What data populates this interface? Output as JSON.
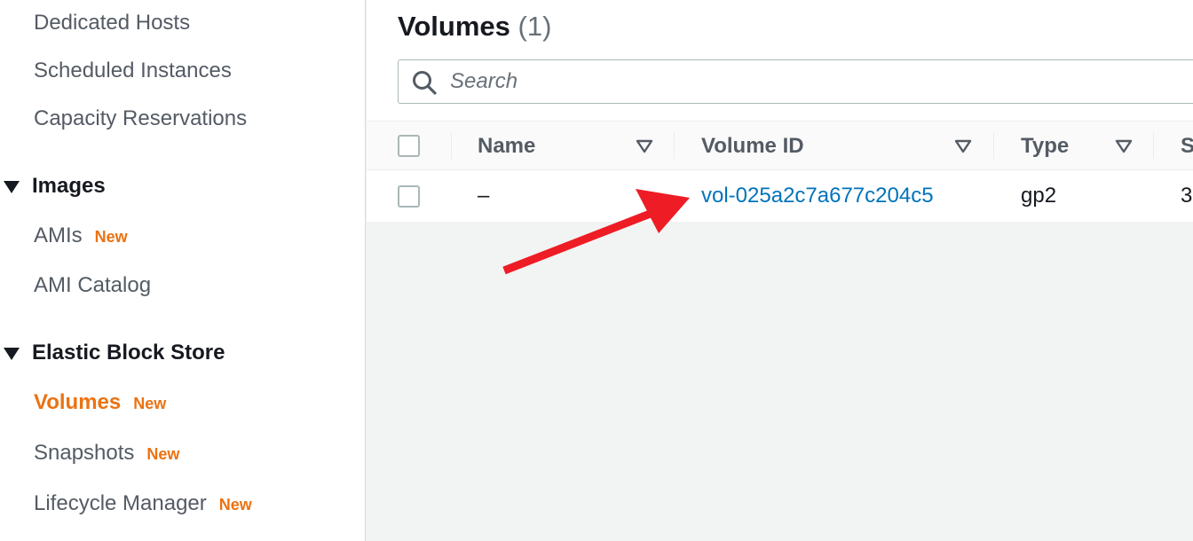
{
  "sidebar": {
    "items_top": [
      {
        "label": "Dedicated Hosts"
      },
      {
        "label": "Scheduled Instances"
      },
      {
        "label": "Capacity Reservations"
      }
    ],
    "images_section": {
      "label": "Images",
      "items": [
        {
          "label": "AMIs",
          "badge": "New"
        },
        {
          "label": "AMI Catalog"
        }
      ]
    },
    "ebs_section": {
      "label": "Elastic Block Store",
      "items": [
        {
          "label": "Volumes",
          "badge": "New",
          "active": true
        },
        {
          "label": "Snapshots",
          "badge": "New"
        },
        {
          "label": "Lifecycle Manager",
          "badge": "New"
        }
      ]
    }
  },
  "main": {
    "title": "Volumes",
    "count": "(1)",
    "search": {
      "placeholder": "Search",
      "value": ""
    },
    "table": {
      "columns": [
        "Name",
        "Volume ID",
        "Type",
        "S"
      ],
      "rows": [
        {
          "name": "–",
          "volume_id": "vol-025a2c7a677c204c5",
          "type": "gp2",
          "size": "3"
        }
      ]
    }
  },
  "colors": {
    "accent": "#ec7211",
    "link": "#0073bb",
    "annotation_arrow": "#ee1c25"
  },
  "icons": [
    "search-icon",
    "sort-icon",
    "caret-down-icon",
    "annotation-arrow"
  ]
}
